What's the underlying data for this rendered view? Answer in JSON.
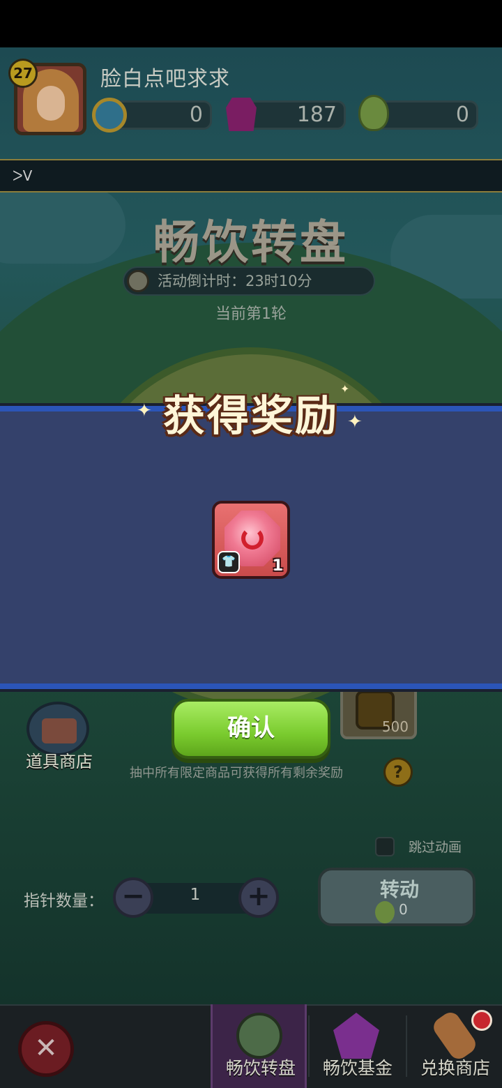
{
  "player": {
    "level": "27",
    "name": "脸白点吧求求",
    "resources": [
      {
        "icon": "coin-icon",
        "value": "0"
      },
      {
        "icon": "gem-icon",
        "value": "187"
      },
      {
        "icon": "hop-icon",
        "value": "0"
      }
    ]
  },
  "banner": {
    "text": "ᐳV"
  },
  "event": {
    "title": "畅饮转盘",
    "countdown": "活动倒计时：23时10分",
    "round": "当前第1轮"
  },
  "wheel": {
    "visible_item_value": "500"
  },
  "reward_modal": {
    "title": "获得奖励",
    "items": [
      {
        "icon": "swirl-candy-gem-icon",
        "tag_icon": "shirt-icon",
        "quantity": "1"
      }
    ],
    "confirm_label": "确认"
  },
  "shop": {
    "label": "道具商店"
  },
  "rule_text": "抽中所有限定商品可获得所有剩余奖励",
  "help_label": "?",
  "skip_animation": {
    "label": "跳过动画",
    "checked": false
  },
  "pointer": {
    "label": "指针数量：",
    "value": "1",
    "minus": "−",
    "plus": "+"
  },
  "spin": {
    "label": "转动",
    "cost": "0"
  },
  "close_label": "✕",
  "nav": {
    "tabs": [
      {
        "label": "畅饮转盘",
        "active": true
      },
      {
        "label": "畅饮基金",
        "active": false
      },
      {
        "label": "兑换商店",
        "active": false
      }
    ]
  },
  "colors": {
    "modal_bg": "#34416b",
    "modal_border": "#2b55b8",
    "confirm_green": "#7acb2e",
    "nav_active": "#3c2448"
  }
}
